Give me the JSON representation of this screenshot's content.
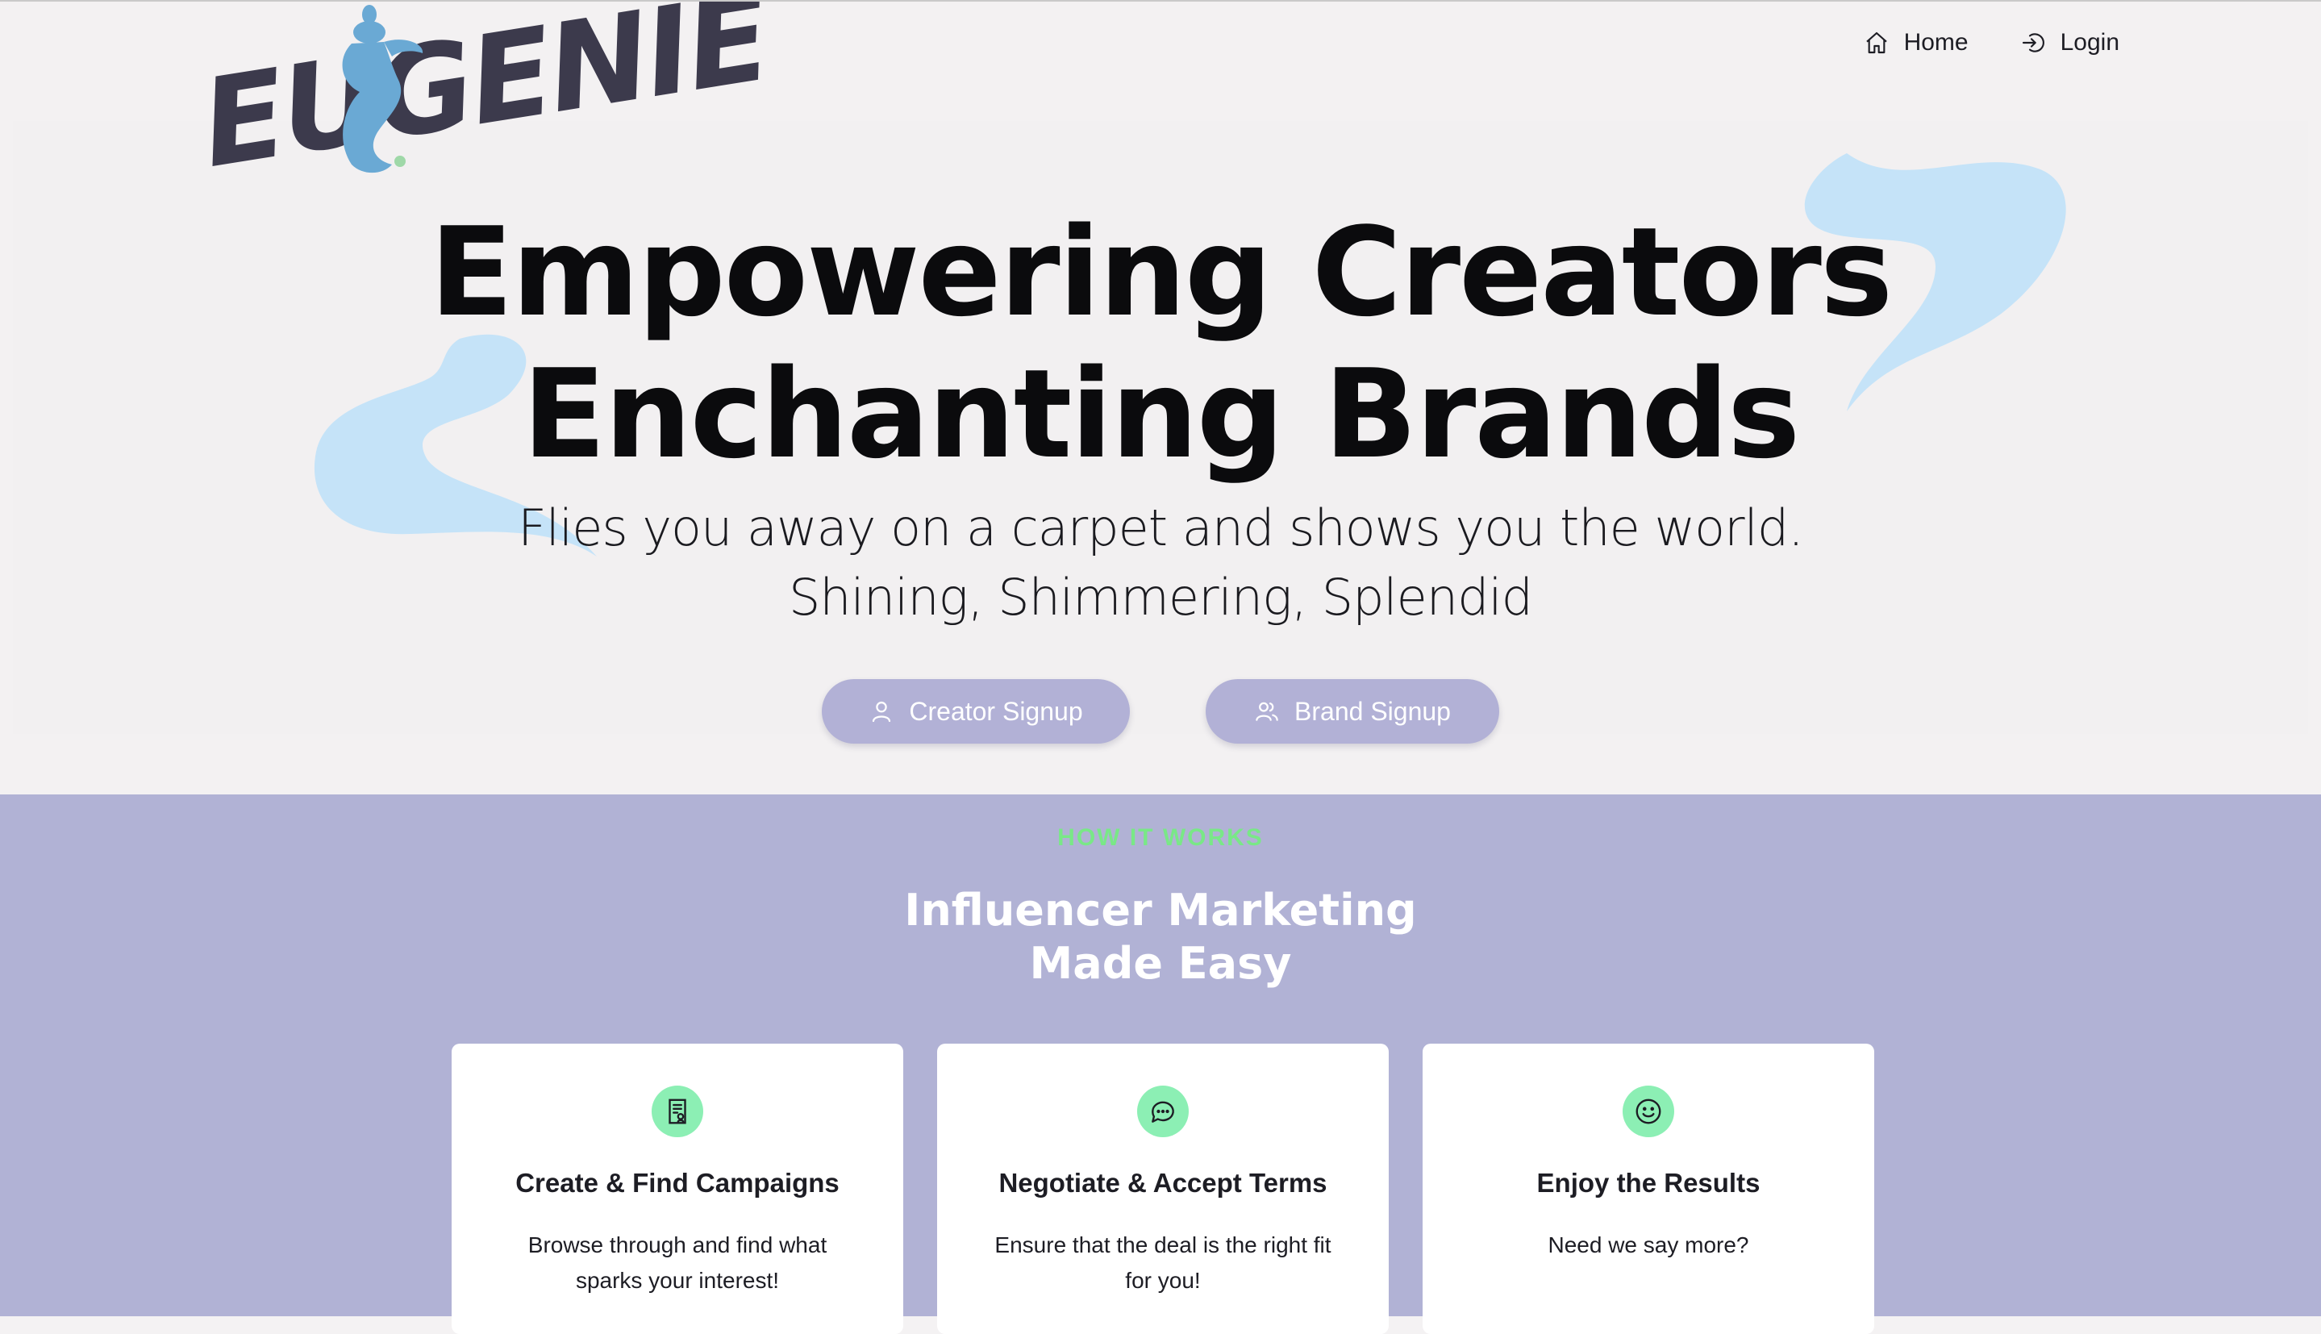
{
  "brand": {
    "logo_text": "EUGENIE",
    "colors": {
      "logo_text": "#3c3a4c",
      "logo_figure": "#6aa9d4",
      "swirl": "#c5e3f8"
    }
  },
  "nav": {
    "items": [
      {
        "label": "Home",
        "icon": "home-icon"
      },
      {
        "label": "Login",
        "icon": "login-icon"
      }
    ]
  },
  "hero": {
    "headline": [
      "Empowering Creators",
      "Enchanting Brands"
    ],
    "tagline": [
      "Flies you away on a carpet and shows you the world.",
      "Shining, Shimmering, Splendid"
    ],
    "buttons": {
      "creator": {
        "label": "Creator Signup",
        "icon": "user-icon"
      },
      "brand": {
        "label": "Brand Signup",
        "icon": "users-icon"
      }
    },
    "colors": {
      "button_bg": "#b2b1d6",
      "background": "#f3f1f2"
    }
  },
  "how_it_works": {
    "eyebrow": "HOW IT WORKS",
    "title": [
      "Influencer Marketing",
      "Made Easy"
    ],
    "colors": {
      "section_bg": "#b1b2d5",
      "eyebrow": "#79e887",
      "icon_bg": "#8cefb4"
    },
    "cards": [
      {
        "title": "Create & Find Campaigns",
        "text": "Browse through and find what sparks your interest!",
        "icon": "campaign-document-icon"
      },
      {
        "title": "Negotiate & Accept Terms",
        "text": "Ensure that the deal is the right fit for you!",
        "icon": "chat-bubbles-icon"
      },
      {
        "title": "Enjoy the Results",
        "text": "Need we say more?",
        "icon": "smiley-icon"
      }
    ]
  }
}
